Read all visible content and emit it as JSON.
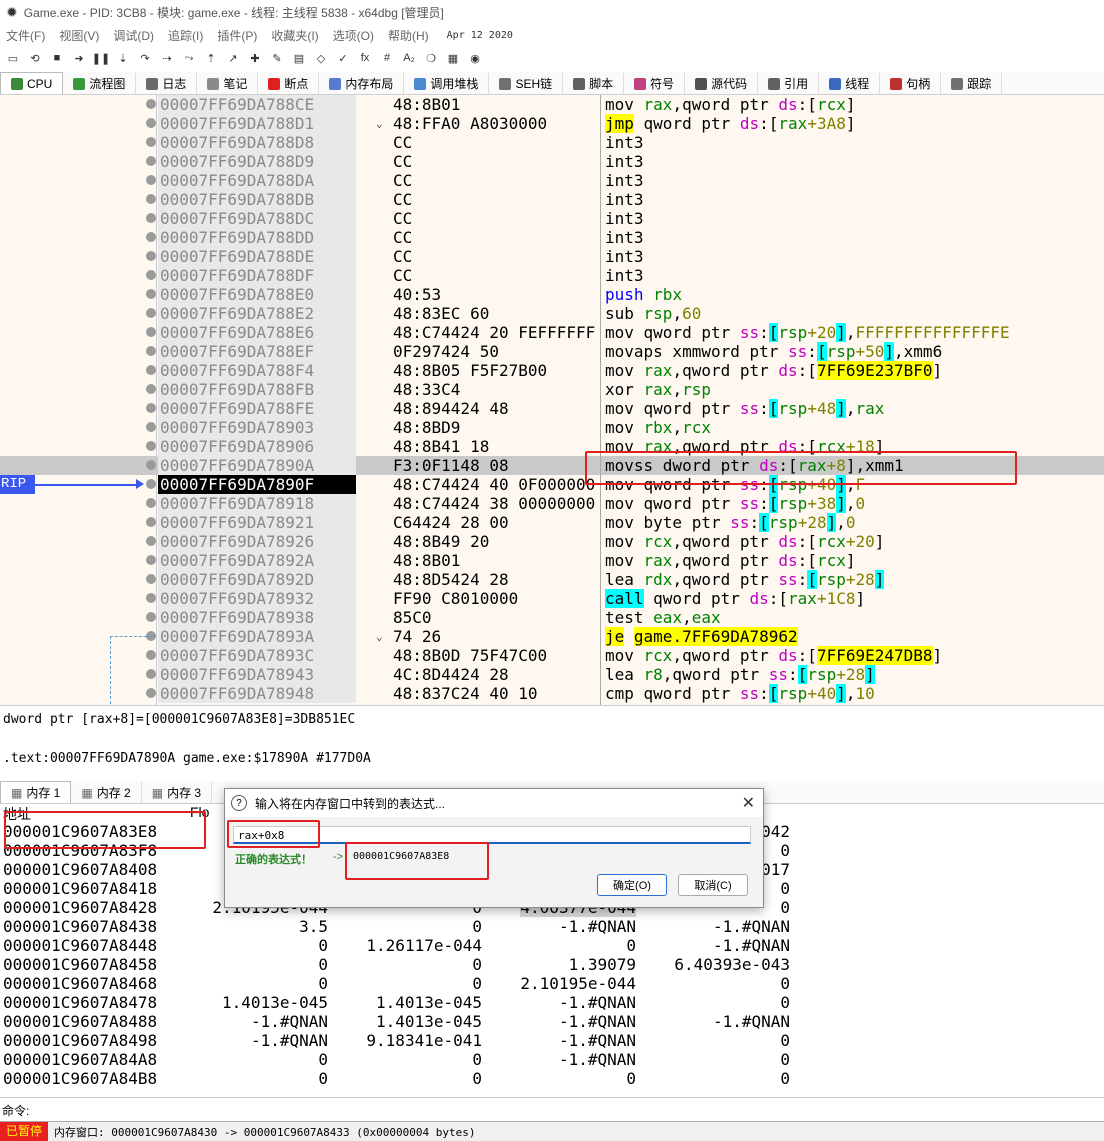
{
  "title": "Game.exe - PID: 3CB8 - 模块: game.exe - 线程: 主线程 5838 - x64dbg [管理员]",
  "menu": [
    "文件(F)",
    "视图(V)",
    "调试(D)",
    "追踪(I)",
    "插件(P)",
    "收藏夹(I)",
    "选项(O)",
    "帮助(H)"
  ],
  "menu_date": "Apr 12 2020",
  "toolbar_icons": [
    "open-icon",
    "restart-icon",
    "stop-icon",
    "run-icon",
    "pause-icon",
    "step-into-icon",
    "step-over-icon",
    "trace-into-icon",
    "trace-over-icon",
    "execute-till-return-icon",
    "run-to-user-code-icon",
    "scylla-icon",
    "patch-icon",
    "comment-icon",
    "label-icon",
    "bookmark-icon",
    "function-icon",
    "hash-icon",
    "font-icon",
    "script-icon",
    "calculator-icon",
    "about-icon"
  ],
  "toolbar_glyphs": [
    "▭",
    "⟲",
    "■",
    "➜",
    "❚❚",
    "⇣",
    "↷",
    "⇢",
    "⤳",
    "⇡",
    "↗",
    "✚",
    "✎",
    "▤",
    "◇",
    "✓",
    "fx",
    "#",
    "A₂",
    "❍",
    "▦",
    "◉"
  ],
  "tabs": [
    {
      "label": "CPU",
      "color": "#3a8a3a"
    },
    {
      "label": "流程图",
      "color": "#3a9a3a"
    },
    {
      "label": "日志",
      "color": "#6a6a6a"
    },
    {
      "label": "笔记",
      "color": "#8a8a8a"
    },
    {
      "label": "断点",
      "color": "#e02020"
    },
    {
      "label": "内存布局",
      "color": "#5a7ad0"
    },
    {
      "label": "调用堆栈",
      "color": "#4a8ad0"
    },
    {
      "label": "SEH链",
      "color": "#707070"
    },
    {
      "label": "脚本",
      "color": "#606060"
    },
    {
      "label": "符号",
      "color": "#c04080"
    },
    {
      "label": "源代码",
      "color": "#505050"
    },
    {
      "label": "引用",
      "color": "#606060"
    },
    {
      "label": "线程",
      "color": "#3a6ac0"
    },
    {
      "label": "句柄",
      "color": "#c03030"
    },
    {
      "label": "跟踪",
      "color": "#707070"
    }
  ],
  "rip_label": "RIP",
  "disasm": [
    {
      "addr": "00007FF69DA788CE",
      "bytes": "48:8B01",
      "arrow": "",
      "dis": [
        [
          "mn",
          "mov "
        ],
        [
          "reg",
          "rax"
        ],
        [
          "mn",
          ","
        ],
        [
          "mn",
          "qword ptr "
        ],
        [
          "seg",
          "ds"
        ],
        [
          "mn",
          ":["
        ],
        [
          "reg",
          "rcx"
        ],
        [
          "mn",
          "]"
        ]
      ]
    },
    {
      "addr": "00007FF69DA788D1",
      "bytes": "48:FFA0 A8030000",
      "arrow": "⌄",
      "dis": [
        [
          "jmp",
          "jmp"
        ],
        [
          "mn",
          " qword ptr "
        ],
        [
          "seg",
          "ds"
        ],
        [
          "mn",
          ":["
        ],
        [
          "reg",
          "rax"
        ],
        [
          "num",
          "+3A8"
        ],
        [
          "mn",
          "]"
        ]
      ]
    },
    {
      "addr": "00007FF69DA788D8",
      "bytes": "CC",
      "arrow": "",
      "dis": [
        [
          "mn",
          "int3"
        ]
      ]
    },
    {
      "addr": "00007FF69DA788D9",
      "bytes": "CC",
      "arrow": "",
      "dis": [
        [
          "mn",
          "int3"
        ]
      ]
    },
    {
      "addr": "00007FF69DA788DA",
      "bytes": "CC",
      "arrow": "",
      "dis": [
        [
          "mn",
          "int3"
        ]
      ]
    },
    {
      "addr": "00007FF69DA788DB",
      "bytes": "CC",
      "arrow": "",
      "dis": [
        [
          "mn",
          "int3"
        ]
      ]
    },
    {
      "addr": "00007FF69DA788DC",
      "bytes": "CC",
      "arrow": "",
      "dis": [
        [
          "mn",
          "int3"
        ]
      ]
    },
    {
      "addr": "00007FF69DA788DD",
      "bytes": "CC",
      "arrow": "",
      "dis": [
        [
          "mn",
          "int3"
        ]
      ]
    },
    {
      "addr": "00007FF69DA788DE",
      "bytes": "CC",
      "arrow": "",
      "dis": [
        [
          "mn",
          "int3"
        ]
      ]
    },
    {
      "addr": "00007FF69DA788DF",
      "bytes": "CC",
      "arrow": "",
      "dis": [
        [
          "mn",
          "int3"
        ]
      ]
    },
    {
      "addr": "00007FF69DA788E0",
      "bytes": "40:53",
      "arrow": "",
      "dis": [
        [
          "push",
          "push "
        ],
        [
          "reg",
          "rbx"
        ]
      ]
    },
    {
      "addr": "00007FF69DA788E2",
      "bytes": "48:83EC 60",
      "arrow": "",
      "dis": [
        [
          "mn",
          "sub "
        ],
        [
          "reg",
          "rsp"
        ],
        [
          "mn",
          ","
        ],
        [
          "num",
          "60"
        ]
      ]
    },
    {
      "addr": "00007FF69DA788E6",
      "bytes": "48:C74424 20 FEFFFFFF",
      "arrow": "",
      "dis": [
        [
          "mn",
          "mov qword ptr "
        ],
        [
          "seg",
          "ss"
        ],
        [
          "mn",
          ":"
        ],
        [
          "br",
          "["
        ],
        [
          "reg",
          "rsp"
        ],
        [
          "num",
          "+20"
        ],
        [
          "br",
          "]"
        ],
        [
          "mn",
          ","
        ],
        [
          "num",
          "FFFFFFFFFFFFFFFE"
        ]
      ]
    },
    {
      "addr": "00007FF69DA788EF",
      "bytes": "0F297424 50",
      "arrow": "",
      "dis": [
        [
          "mn",
          "movaps xmmword ptr "
        ],
        [
          "seg",
          "ss"
        ],
        [
          "mn",
          ":"
        ],
        [
          "br",
          "["
        ],
        [
          "reg",
          "rsp"
        ],
        [
          "num",
          "+50"
        ],
        [
          "br",
          "]"
        ],
        [
          "mn",
          ",xmm6"
        ]
      ]
    },
    {
      "addr": "00007FF69DA788F4",
      "bytes": "48:8B05 F5F27B00",
      "arrow": "",
      "dis": [
        [
          "mn",
          "mov "
        ],
        [
          "reg",
          "rax"
        ],
        [
          "mn",
          ",qword ptr "
        ],
        [
          "seg",
          "ds"
        ],
        [
          "mn",
          ":["
        ],
        [
          "imm",
          "7FF69E237BF0"
        ],
        [
          "mn",
          "]"
        ]
      ]
    },
    {
      "addr": "00007FF69DA788FB",
      "bytes": "48:33C4",
      "arrow": "",
      "dis": [
        [
          "mn",
          "xor "
        ],
        [
          "reg",
          "rax"
        ],
        [
          "mn",
          ","
        ],
        [
          "reg",
          "rsp"
        ]
      ]
    },
    {
      "addr": "00007FF69DA788FE",
      "bytes": "48:894424 48",
      "arrow": "",
      "dis": [
        [
          "mn",
          "mov qword ptr "
        ],
        [
          "seg",
          "ss"
        ],
        [
          "mn",
          ":"
        ],
        [
          "br",
          "["
        ],
        [
          "reg",
          "rsp"
        ],
        [
          "num",
          "+48"
        ],
        [
          "br",
          "]"
        ],
        [
          "mn",
          ","
        ],
        [
          "reg",
          "rax"
        ]
      ]
    },
    {
      "addr": "00007FF69DA78903",
      "bytes": "48:8BD9",
      "arrow": "",
      "dis": [
        [
          "mn",
          "mov "
        ],
        [
          "reg",
          "rbx"
        ],
        [
          "mn",
          ","
        ],
        [
          "reg",
          "rcx"
        ]
      ]
    },
    {
      "addr": "00007FF69DA78906",
      "bytes": "48:8B41 18",
      "arrow": "",
      "dis": [
        [
          "mn",
          "mov "
        ],
        [
          "reg",
          "rax"
        ],
        [
          "mn",
          ",qword ptr "
        ],
        [
          "seg",
          "ds"
        ],
        [
          "mn",
          ":["
        ],
        [
          "reg",
          "rcx"
        ],
        [
          "num",
          "+18"
        ],
        [
          "mn",
          "]"
        ]
      ]
    },
    {
      "addr": "00007FF69DA7890A",
      "bytes": "F3:0F1148 08",
      "arrow": "",
      "sel": true,
      "dis": [
        [
          "mn",
          "movss dword ptr "
        ],
        [
          "seg",
          "ds"
        ],
        [
          "mn",
          ":["
        ],
        [
          "reg",
          "rax"
        ],
        [
          "num",
          "+8"
        ],
        [
          "mn",
          "],xmm1"
        ]
      ]
    },
    {
      "addr": "00007FF69DA7890F",
      "bytes": "48:C74424 40 0F000000",
      "arrow": "",
      "cur": true,
      "dis": [
        [
          "mn",
          "mov qword ptr "
        ],
        [
          "seg",
          "ss"
        ],
        [
          "mn",
          ":"
        ],
        [
          "br",
          "["
        ],
        [
          "reg",
          "rsp"
        ],
        [
          "num",
          "+40"
        ],
        [
          "br",
          "]"
        ],
        [
          "mn",
          ","
        ],
        [
          "num",
          "F"
        ]
      ]
    },
    {
      "addr": "00007FF69DA78918",
      "bytes": "48:C74424 38 00000000",
      "arrow": "",
      "dis": [
        [
          "mn",
          "mov qword ptr "
        ],
        [
          "seg",
          "ss"
        ],
        [
          "mn",
          ":"
        ],
        [
          "br",
          "["
        ],
        [
          "reg",
          "rsp"
        ],
        [
          "num",
          "+38"
        ],
        [
          "br",
          "]"
        ],
        [
          "mn",
          ","
        ],
        [
          "num",
          "0"
        ]
      ]
    },
    {
      "addr": "00007FF69DA78921",
      "bytes": "C64424 28 00",
      "arrow": "",
      "dis": [
        [
          "mn",
          "mov byte ptr "
        ],
        [
          "seg",
          "ss"
        ],
        [
          "mn",
          ":"
        ],
        [
          "br",
          "["
        ],
        [
          "reg",
          "rsp"
        ],
        [
          "num",
          "+28"
        ],
        [
          "br",
          "]"
        ],
        [
          "mn",
          ","
        ],
        [
          "num",
          "0"
        ]
      ]
    },
    {
      "addr": "00007FF69DA78926",
      "bytes": "48:8B49 20",
      "arrow": "",
      "dis": [
        [
          "mn",
          "mov "
        ],
        [
          "reg",
          "rcx"
        ],
        [
          "mn",
          ",qword ptr "
        ],
        [
          "seg",
          "ds"
        ],
        [
          "mn",
          ":["
        ],
        [
          "reg",
          "rcx"
        ],
        [
          "num",
          "+20"
        ],
        [
          "mn",
          "]"
        ]
      ]
    },
    {
      "addr": "00007FF69DA7892A",
      "bytes": "48:8B01",
      "arrow": "",
      "dis": [
        [
          "mn",
          "mov "
        ],
        [
          "reg",
          "rax"
        ],
        [
          "mn",
          ",qword ptr "
        ],
        [
          "seg",
          "ds"
        ],
        [
          "mn",
          ":["
        ],
        [
          "reg",
          "rcx"
        ],
        [
          "mn",
          "]"
        ]
      ]
    },
    {
      "addr": "00007FF69DA7892D",
      "bytes": "48:8D5424 28",
      "arrow": "",
      "dis": [
        [
          "mn",
          "lea "
        ],
        [
          "reg",
          "rdx"
        ],
        [
          "mn",
          ",qword ptr "
        ],
        [
          "seg",
          "ss"
        ],
        [
          "mn",
          ":"
        ],
        [
          "br",
          "["
        ],
        [
          "reg",
          "rsp"
        ],
        [
          "num",
          "+28"
        ],
        [
          "br",
          "]"
        ]
      ]
    },
    {
      "addr": "00007FF69DA78932",
      "bytes": "FF90 C8010000",
      "arrow": "",
      "dis": [
        [
          "call",
          "call"
        ],
        [
          "mn",
          " qword ptr "
        ],
        [
          "seg",
          "ds"
        ],
        [
          "mn",
          ":["
        ],
        [
          "reg",
          "rax"
        ],
        [
          "num",
          "+1C8"
        ],
        [
          "mn",
          "]"
        ]
      ]
    },
    {
      "addr": "00007FF69DA78938",
      "bytes": "85C0",
      "arrow": "",
      "dis": [
        [
          "mn",
          "test "
        ],
        [
          "reg",
          "eax"
        ],
        [
          "mn",
          ","
        ],
        [
          "reg",
          "eax"
        ]
      ]
    },
    {
      "addr": "00007FF69DA7893A",
      "bytes": "74 26",
      "arrow": "⌄",
      "dis": [
        [
          "jmp",
          "je"
        ],
        [
          "mn",
          " "
        ],
        [
          "imm",
          "game.7FF69DA78962"
        ]
      ]
    },
    {
      "addr": "00007FF69DA7893C",
      "bytes": "48:8B0D 75F47C00",
      "arrow": "",
      "dis": [
        [
          "mn",
          "mov "
        ],
        [
          "reg",
          "rcx"
        ],
        [
          "mn",
          ",qword ptr "
        ],
        [
          "seg",
          "ds"
        ],
        [
          "mn",
          ":["
        ],
        [
          "imm",
          "7FF69E247DB8"
        ],
        [
          "mn",
          "]"
        ]
      ]
    },
    {
      "addr": "00007FF69DA78943",
      "bytes": "4C:8D4424 28",
      "arrow": "",
      "dis": [
        [
          "mn",
          "lea "
        ],
        [
          "reg",
          "r8"
        ],
        [
          "mn",
          ",qword ptr "
        ],
        [
          "seg",
          "ss"
        ],
        [
          "mn",
          ":"
        ],
        [
          "br",
          "["
        ],
        [
          "reg",
          "rsp"
        ],
        [
          "num",
          "+28"
        ],
        [
          "br",
          "]"
        ]
      ]
    },
    {
      "addr": "00007FF69DA78948",
      "bytes": "48:837C24 40 10",
      "arrow": "",
      "dis": [
        [
          "mn",
          "cmp qword ptr "
        ],
        [
          "seg",
          "ss"
        ],
        [
          "mn",
          ":"
        ],
        [
          "br",
          "["
        ],
        [
          "reg",
          "rsp"
        ],
        [
          "num",
          "+40"
        ],
        [
          "br",
          "]"
        ],
        [
          "mn",
          ","
        ],
        [
          "num",
          "10"
        ]
      ]
    }
  ],
  "info_line1": "dword ptr [rax+8]=[000001C9607A83E8]=3DB851EC",
  "info_line2": ".text:00007FF69DA7890A game.exe:$17890A #177D0A",
  "mem_tabs": [
    "内存 1",
    "内存 2",
    "内存 3"
  ],
  "mem_header": {
    "addr": "地址",
    "col": "Flo"
  },
  "memory": [
    {
      "addr": "000001C9607A83E8",
      "c": [
        "",
        "",
        "",
        "042"
      ]
    },
    {
      "addr": "000001C9607A83F8",
      "c": [
        "",
        "",
        "",
        "0"
      ]
    },
    {
      "addr": "000001C9607A8408",
      "c": [
        "3.",
        "",
        "",
        "017"
      ]
    },
    {
      "addr": "000001C9607A8418",
      "c": [
        "1.",
        "",
        "",
        "0"
      ]
    },
    {
      "addr": "000001C9607A8428",
      "c": [
        "2.10195e-044",
        "0",
        "4.06377e-044",
        "0"
      ]
    },
    {
      "addr": "000001C9607A8438",
      "c": [
        "3.5",
        "0",
        "-1.#QNAN",
        "-1.#QNAN"
      ]
    },
    {
      "addr": "000001C9607A8448",
      "c": [
        "0",
        "1.26117e-044",
        "0",
        "-1.#QNAN"
      ]
    },
    {
      "addr": "000001C9607A8458",
      "c": [
        "0",
        "0",
        "1.39079",
        "6.40393e-043"
      ]
    },
    {
      "addr": "000001C9607A8468",
      "c": [
        "0",
        "0",
        "2.10195e-044",
        "0"
      ]
    },
    {
      "addr": "000001C9607A8478",
      "c": [
        "1.4013e-045",
        "1.4013e-045",
        "-1.#QNAN",
        "0"
      ]
    },
    {
      "addr": "000001C9607A8488",
      "c": [
        "-1.#QNAN",
        "1.4013e-045",
        "-1.#QNAN",
        "-1.#QNAN"
      ]
    },
    {
      "addr": "000001C9607A8498",
      "c": [
        "-1.#QNAN",
        "9.18341e-041",
        "-1.#QNAN",
        "0"
      ]
    },
    {
      "addr": "000001C9607A84A8",
      "c": [
        "0",
        "0",
        "-1.#QNAN",
        "0"
      ]
    },
    {
      "addr": "000001C9607A84B8",
      "c": [
        "0",
        "0",
        "0",
        "0"
      ]
    }
  ],
  "dialog": {
    "title": "输入将在内存窗口中转到的表达式...",
    "input_value": "rax+0x8",
    "status": "正确的表达式！",
    "arrow": "->",
    "result": "000001C9607A83E8",
    "ok": "确定(O)",
    "cancel": "取消(C)"
  },
  "command_label": "命令:",
  "status_paused": "已暂停",
  "status_text": "内存窗口: 000001C9607A8430 -> 000001C9607A8433 (0x00000004 bytes)"
}
